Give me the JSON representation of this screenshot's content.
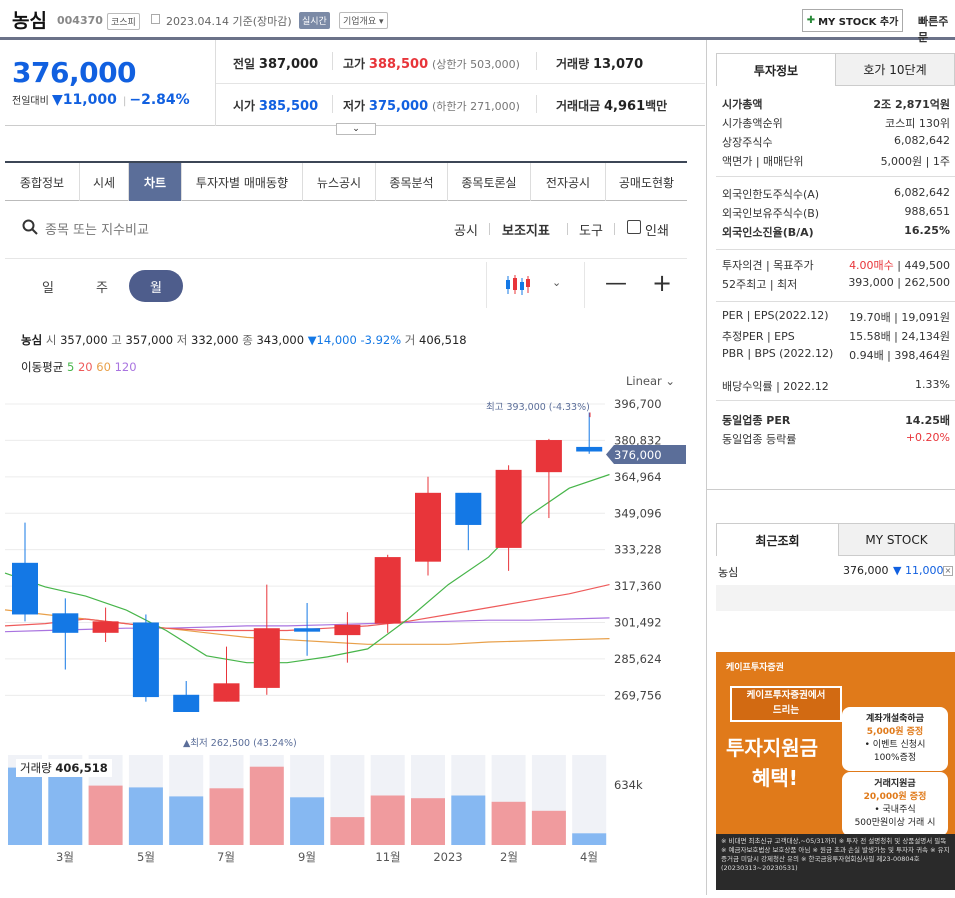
{
  "header": {
    "name": "농심",
    "code": "004370",
    "market": "코스피",
    "date_text": "2023.04.14 기준(장마감)",
    "live": "실시간",
    "company_overview": "기업개요",
    "my_stock_add": "MY STOCK 추가",
    "quick_order": "빠른주문"
  },
  "price": {
    "current": "376,000",
    "diff_label": "전일대비",
    "diff": "11,000",
    "diff_pct": "−2.84%",
    "prev_label": "전일",
    "prev": "387,000",
    "high_label": "고가",
    "high": "388,500",
    "upper_limit": "(상한가 503,000)",
    "volume_label": "거래량",
    "volume": "13,070",
    "open_label": "시가",
    "open": "385,500",
    "low_label": "저가",
    "low": "375,000",
    "lower_limit": "(하한가 271,000)",
    "amount_label": "거래대금",
    "amount": "4,961",
    "amount_unit": "백만"
  },
  "tabs": [
    "종합정보",
    "시세",
    "차트",
    "투자자별 매매동향",
    "뉴스공시",
    "종목분석",
    "종목토론실",
    "전자공시",
    "공매도현황"
  ],
  "search": {
    "placeholder": "종목 또는 지수비교",
    "tools": [
      "공시",
      "보조지표",
      "도구",
      "인쇄"
    ]
  },
  "periods": [
    "일",
    "주",
    "월"
  ],
  "chart_info": {
    "name": "농심",
    "open_label": "시",
    "open": "357,000",
    "high_label": "고",
    "high": "357,000",
    "low_label": "저",
    "low": "332,000",
    "close_label": "종",
    "close": "343,000",
    "change": "▼14,000 -3.92%",
    "vol_label": "거",
    "vol": "406,518",
    "ma_label": "이동평균",
    "ma": [
      "5",
      "20",
      "60",
      "120"
    ],
    "scale": "Linear",
    "max_label": "최고 393,000 (-4.33%)",
    "min_label": "▲최저 262,500 (43.24%)",
    "current_tag": "376,000",
    "volume_label": "거래량",
    "volume_value": "406,518",
    "volume_axis": "634k"
  },
  "chart_data": {
    "type": "candlestick",
    "y_ticks": [
      "396,700",
      "380,832",
      "364,964",
      "349,096",
      "333,228",
      "317,360",
      "301,492",
      "285,624",
      "269,756"
    ],
    "x_labels": [
      "3월",
      "5월",
      "7월",
      "9월",
      "11월",
      "2023",
      "2월",
      "4월"
    ],
    "ylim": [
      262500,
      396700
    ],
    "candles": [
      {
        "open": 327500,
        "close": 305000,
        "high": 345000,
        "low": 302000,
        "volume": 0.86
      },
      {
        "open": 305500,
        "close": 297000,
        "high": 312000,
        "low": 281000,
        "volume": 0.83
      },
      {
        "open": 297000,
        "close": 302000,
        "high": 308000,
        "low": 293000,
        "volume": 0.66
      },
      {
        "open": 301500,
        "close": 269000,
        "high": 305000,
        "low": 267000,
        "volume": 0.64
      },
      {
        "open": 270000,
        "close": 262500,
        "high": 276000,
        "low": 262500,
        "volume": 0.54
      },
      {
        "open": 267000,
        "close": 275000,
        "high": 291000,
        "low": 267000,
        "volume": 0.63
      },
      {
        "open": 273000,
        "close": 299000,
        "high": 318000,
        "low": 270000,
        "volume": 0.87
      },
      {
        "open": 299000,
        "close": 297500,
        "high": 310000,
        "low": 287000,
        "volume": 0.53
      },
      {
        "open": 296000,
        "close": 300500,
        "high": 306000,
        "low": 284000,
        "volume": 0.31
      },
      {
        "open": 301000,
        "close": 330000,
        "high": 331000,
        "low": 297000,
        "volume": 0.55
      },
      {
        "open": 328000,
        "close": 358000,
        "high": 365000,
        "low": 322000,
        "volume": 0.52
      },
      {
        "open": 358000,
        "close": 344000,
        "high": 358000,
        "low": 333000,
        "volume": 0.55
      },
      {
        "open": 334000,
        "close": 368000,
        "high": 370000,
        "low": 324000,
        "volume": 0.48
      },
      {
        "open": 367000,
        "close": 381000,
        "high": 381500,
        "low": 347000,
        "volume": 0.38
      },
      {
        "open": 378000,
        "close": 376000,
        "high": 393000,
        "low": 375000,
        "volume": 0.13
      }
    ],
    "ma5": [
      323000,
      317000,
      313000,
      307000,
      298000,
      287000,
      284000,
      284000,
      286500,
      290000,
      303000,
      318000,
      330000,
      348000,
      360000,
      366000
    ],
    "ma20": [
      300000,
      301000,
      303000,
      301000,
      299000,
      298000,
      298000,
      298000,
      299000,
      300000,
      302000,
      305000,
      308000,
      311000,
      314000,
      318000
    ],
    "ma60": [
      307000,
      305000,
      303000,
      301000,
      299000,
      297000,
      295000,
      294000,
      293000,
      292000,
      292000,
      292000,
      293000,
      293500,
      294000,
      294500
    ],
    "ma120": [
      297500,
      298000,
      298500,
      299000,
      299000,
      299500,
      300000,
      300000,
      300500,
      301000,
      301500,
      302000,
      302500,
      302500,
      303000,
      303500
    ]
  },
  "right": {
    "tabs": [
      "투자정보",
      "호가 10단계"
    ],
    "rows": [
      {
        "label": "시가총액",
        "value": "2조 2,871억원",
        "bold": true
      },
      {
        "label": "시가총액순위",
        "value": "코스피 130위"
      },
      {
        "label": "상장주식수",
        "value": "6,082,642"
      },
      {
        "label": "액면가 | 매매단위",
        "value": "5,000원 | 1주"
      },
      {
        "label": "외국인한도주식수(A)",
        "value": "6,082,642"
      },
      {
        "label": "외국인보유주식수(B)",
        "value": "988,651"
      },
      {
        "label": "외국인소진율(B/A)",
        "value": "16.25%",
        "bold": true
      },
      {
        "label": "투자의견 | 목표주가",
        "value_red": "4.00매수",
        "value": "449,500"
      },
      {
        "label": "52주최고 | 최저",
        "value": "393,000 | 262,500"
      },
      {
        "label": "PER | EPS(2022.12)",
        "value": "19.70배 | 19,091원"
      },
      {
        "label": "추정PER | EPS",
        "value": "15.58배 | 24,134원"
      },
      {
        "label": "PBR | BPS (2022.12)",
        "value": "0.94배 | 398,464원"
      },
      {
        "label": "배당수익률 | 2022.12",
        "value": "1.33%"
      },
      {
        "label": "동일업종 PER",
        "value": "14.25배",
        "bold": true
      },
      {
        "label": "동일업종 등락률",
        "value": "+0.20%"
      }
    ],
    "recent_tabs": [
      "최근조회",
      "MY STOCK"
    ],
    "recent_item": {
      "name": "농심",
      "price": "376,000",
      "change": "▼ 11,000"
    }
  },
  "ad": {
    "brand": "케이프투자증권",
    "line1": "케이프투자증권에서",
    "line2": "드리는",
    "headline1": "투자지원금",
    "headline2": "혜택!",
    "box1_title": "계좌개설축하금",
    "box1_amount": "5,000원 증정",
    "box1_sub1": "• 이벤트 신청시",
    "box1_sub2": "100%증정",
    "box2_title": "거래지원금",
    "box2_amount": "20,000원 증정",
    "box2_sub1": "• 국내주식",
    "box2_sub2": "500만원이상 거래 시",
    "footer": "※ 비대면 최초신규 고객대상,~05/31까지 ※ 투자 전 설명청취 및 상품설명서 필독 ※ 예금자보호법상 보호상품 아님 ※ 원금 초과 손실 발생가능 및 투자자 귀속 ※ 유지증거금 미달시 강제청산 유의 ※ 한국금융투자협회심사필 제23-00804호(20230313~20230531)"
  },
  "colors": {
    "up": "#e8353a",
    "down": "#1478e5",
    "ma5": "#47b54a",
    "ma20": "#ee5b5b",
    "ma60": "#e8a04a",
    "ma120": "#a974e0"
  }
}
